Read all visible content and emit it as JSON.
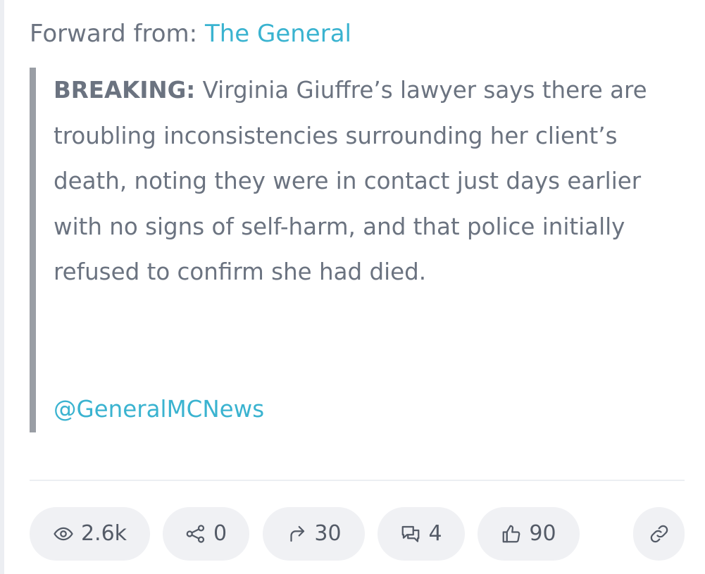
{
  "forward": {
    "prefix": "Forward from:",
    "source": "The General"
  },
  "post": {
    "label": "BREAKING:",
    "text": "Virginia Giuffre’s lawyer says there are troubling inconsistencies surrounding her client’s death, noting they were in contact just days earlier with no signs of self-harm, and that police initially refused to confirm she had died.",
    "handle": "@GeneralMCNews"
  },
  "stats": {
    "views": "2.6k",
    "shares": "0",
    "forwards": "30",
    "comments": "4",
    "likes": "90"
  },
  "icons": {
    "views": "eye-icon",
    "shares": "share-icon",
    "forwards": "forward-arrow-icon",
    "comments": "comments-icon",
    "likes": "thumbs-up-icon",
    "link": "link-icon"
  },
  "colors": {
    "accent": "#3ab3d0",
    "text": "#6b7380",
    "quote_bar": "#9a9ea5",
    "pill_bg": "#f0f1f4"
  }
}
